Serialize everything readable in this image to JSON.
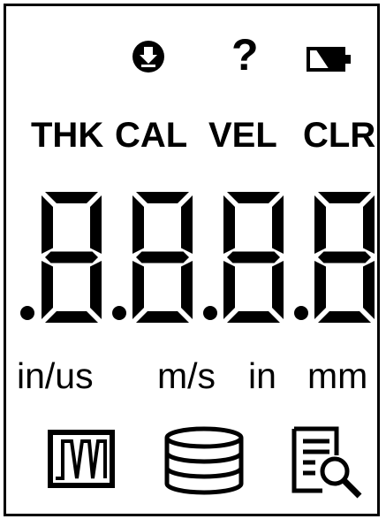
{
  "status_icons": {
    "download": "download-circle-icon",
    "help": "?",
    "battery": "battery-icon"
  },
  "modes": {
    "thk": "THK",
    "cal": "CAL",
    "vel": "VEL",
    "clr": "CLR"
  },
  "display": {
    "digits": "8888",
    "decimal_points": 4
  },
  "units": {
    "in_us": "in/us",
    "m_s": "m/s",
    "in": "in",
    "mm": "mm"
  },
  "bottom_icons": [
    "waveform-icon",
    "database-icon",
    "report-search-icon"
  ],
  "colors": {
    "segment": "#000000",
    "background": "#ffffff"
  }
}
